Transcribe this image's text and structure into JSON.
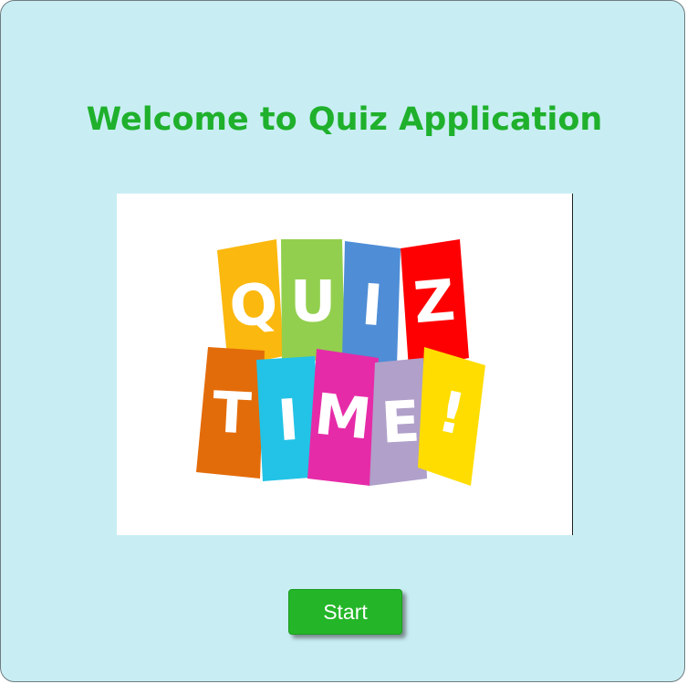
{
  "page": {
    "title": "Welcome to Quiz Application",
    "background_color": "#c8eef3",
    "title_color": "#1fb02c"
  },
  "quiz_image": {
    "alt": "QUIZ TIME!",
    "row1_letters": [
      "Q",
      "U",
      "I",
      "Z"
    ],
    "row2_letters": [
      "T",
      "I",
      "M",
      "E",
      "!"
    ],
    "tile_colors_row1": [
      "#fbb80f",
      "#92cf4e",
      "#4f8dd6",
      "#fe0002"
    ],
    "tile_colors_row2": [
      "#e36c0a",
      "#22c3e6",
      "#e62ba8",
      "#b0a0ca",
      "#ffdd00"
    ]
  },
  "start_button": {
    "label": "Start",
    "color": "#24b628"
  }
}
